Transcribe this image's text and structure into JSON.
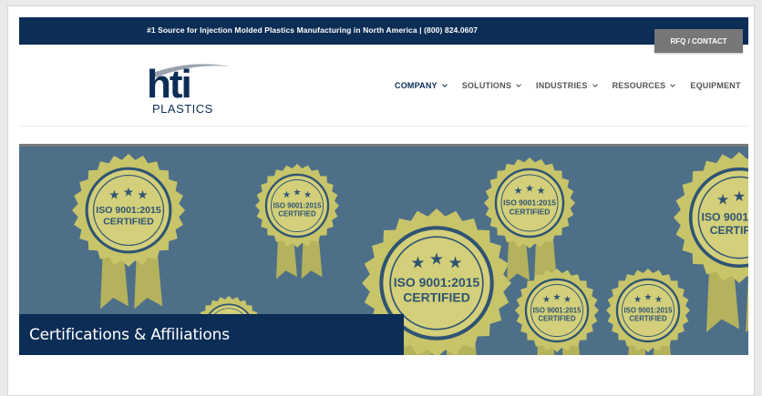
{
  "topbar": {
    "tagline": "#1 Source for Injection Molded Plastics Manufacturing in North America | (800) 824.0607"
  },
  "header": {
    "rfq_label": "RFQ / CONTACT",
    "logo_text": "hti",
    "logo_subtext": "PLASTICS"
  },
  "nav": {
    "items": [
      {
        "label": "COMPANY",
        "has_dropdown": true,
        "active": true
      },
      {
        "label": "SOLUTIONS",
        "has_dropdown": true,
        "active": false
      },
      {
        "label": "INDUSTRIES",
        "has_dropdown": true,
        "active": false
      },
      {
        "label": "RESOURCES",
        "has_dropdown": true,
        "active": false
      },
      {
        "label": "EQUIPMENT",
        "has_dropdown": false,
        "active": false
      }
    ]
  },
  "hero": {
    "caption": "Certifications & Affiliations",
    "seal_line1": "ISO 9001:2015",
    "seal_line2": "CERTIFIED"
  },
  "colors": {
    "navy": "#0c2d55",
    "hero_bg": "#4e6f88",
    "seal_gold": "#c8c46a",
    "rfq_gray": "#777777"
  }
}
